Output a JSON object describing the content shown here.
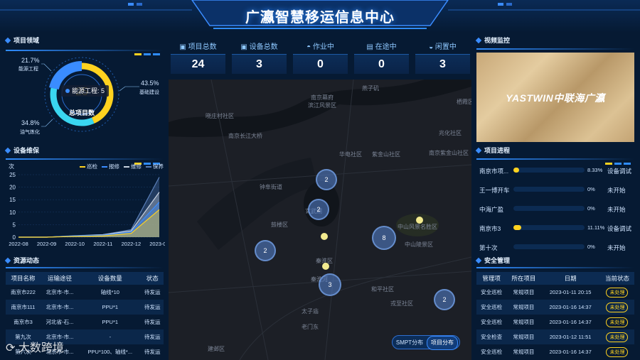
{
  "header": {
    "title": "广瀛智慧移运信息中心"
  },
  "stats": [
    {
      "label": "项目总数",
      "value": "24",
      "icon": "folder-icon"
    },
    {
      "label": "设备总数",
      "value": "3",
      "icon": "device-icon"
    },
    {
      "label": "作业中",
      "value": "0",
      "icon": "helmet-icon"
    },
    {
      "label": "在途中",
      "value": "0",
      "icon": "truck-icon"
    },
    {
      "label": "闲置中",
      "value": "3",
      "icon": "idle-icon"
    }
  ],
  "project_domain": {
    "title": "项目领域",
    "center_value": "25",
    "center_label": "总项目数",
    "tooltip": "能源工程: 5",
    "slices": [
      {
        "name": "能源工程",
        "pct": "21.7%",
        "color": "#3a8cff"
      },
      {
        "name": "基础建设",
        "pct": "43.5%",
        "color": "#ffd21f"
      },
      {
        "name": "油气炼化",
        "pct": "34.8%",
        "color": "#3ad6f0"
      }
    ]
  },
  "chart_data": {
    "type": "area",
    "title": "设备维保",
    "ylabel": "次",
    "x": [
      "2022-08",
      "2022-09",
      "2022-10",
      "2022-11",
      "2022-12",
      "2023-01"
    ],
    "ylim": [
      0,
      25
    ],
    "yticks": [
      0,
      5,
      10,
      15,
      20,
      25
    ],
    "legend_position": "top-right",
    "series": [
      {
        "name": "巡检",
        "color": "#ffd21f",
        "values": [
          0,
          0,
          0.3,
          0.5,
          1.5,
          11
        ]
      },
      {
        "name": "报修",
        "color": "#3a8cff",
        "values": [
          0,
          0,
          0.5,
          0.8,
          2,
          14
        ]
      },
      {
        "name": "维修",
        "color": "#c8d2e0",
        "values": [
          0,
          0,
          0.5,
          1,
          2.5,
          18
        ]
      },
      {
        "name": "保养",
        "color": "#5a7fb8",
        "values": [
          0,
          0,
          0.6,
          1,
          3,
          24
        ]
      }
    ]
  },
  "resource": {
    "title": "资源动态",
    "headers": [
      "项目名称",
      "运输途径",
      "设备数量",
      "状态"
    ],
    "rows": [
      [
        "南京市222",
        "北京市-市...",
        "轴线*10",
        "待发运"
      ],
      [
        "南京市111",
        "北京市-市...",
        "PPU*1",
        "待发运"
      ],
      [
        "南京市3",
        "河北省-石...",
        "PPU*1",
        "待发运"
      ],
      [
        "第九次",
        "北京市-市...",
        "-",
        "待发运"
      ],
      [
        "第六次",
        "北京市-市...",
        "PPU*100、轴线*...",
        "待发运"
      ]
    ]
  },
  "map": {
    "toggle_left": "SMPT分布",
    "toggle_right": "项目分布",
    "labels": [
      "南京幕府",
      "滨江风景区",
      "燕子矶",
      "栖霞区",
      "南京长江大桥",
      "晓庄村社区",
      "兆化社区",
      "华电社区",
      "紫金山社区",
      "南京紫金山社区",
      "钟阜街道",
      "玄武湖",
      "鼓楼区",
      "中山风景名胜区",
      "中山陵景区",
      "秦淮区",
      "秦淮河",
      "戎至社区",
      "太子庙",
      "老门东",
      "建邺区",
      "和平社区"
    ],
    "clusters": [
      "2",
      "2",
      "8",
      "2",
      "3",
      "2"
    ]
  },
  "video": {
    "title": "视频监控",
    "logo": "YASTWIN中联海广瀛"
  },
  "progress": {
    "title": "项目进程",
    "rows": [
      {
        "name": "南京市项...",
        "value": 8.33,
        "pct": "8.33%",
        "status": "设备调试"
      },
      {
        "name": "王一博开车",
        "value": 0,
        "pct": "0%",
        "status": "未开始"
      },
      {
        "name": "中海广盈",
        "value": 0,
        "pct": "0%",
        "status": "未开始"
      },
      {
        "name": "南京市3",
        "value": 11.11,
        "pct": "11.11%",
        "status": "设备调试"
      },
      {
        "name": "第十次",
        "value": 0,
        "pct": "0%",
        "status": "未开始"
      }
    ]
  },
  "safety": {
    "title": "安全管理",
    "headers": [
      "管理项",
      "所在项目",
      "日期",
      "当前状态"
    ],
    "rows": [
      [
        "安全巡检",
        "常规项目",
        "2023-01-11 20:15",
        "未处理"
      ],
      [
        "安全巡检",
        "常规项目",
        "2023-01-16 14:37",
        "未处理"
      ],
      [
        "安全巡检",
        "常规项目",
        "2023-01-16 14:37",
        "未处理"
      ],
      [
        "安全检查",
        "常规项目",
        "2023-01-12 11:51",
        "未处理"
      ],
      [
        "安全巡检",
        "常规项目",
        "2023-01-16 14:37",
        "未处理"
      ]
    ]
  },
  "watermark": "大数跨境"
}
